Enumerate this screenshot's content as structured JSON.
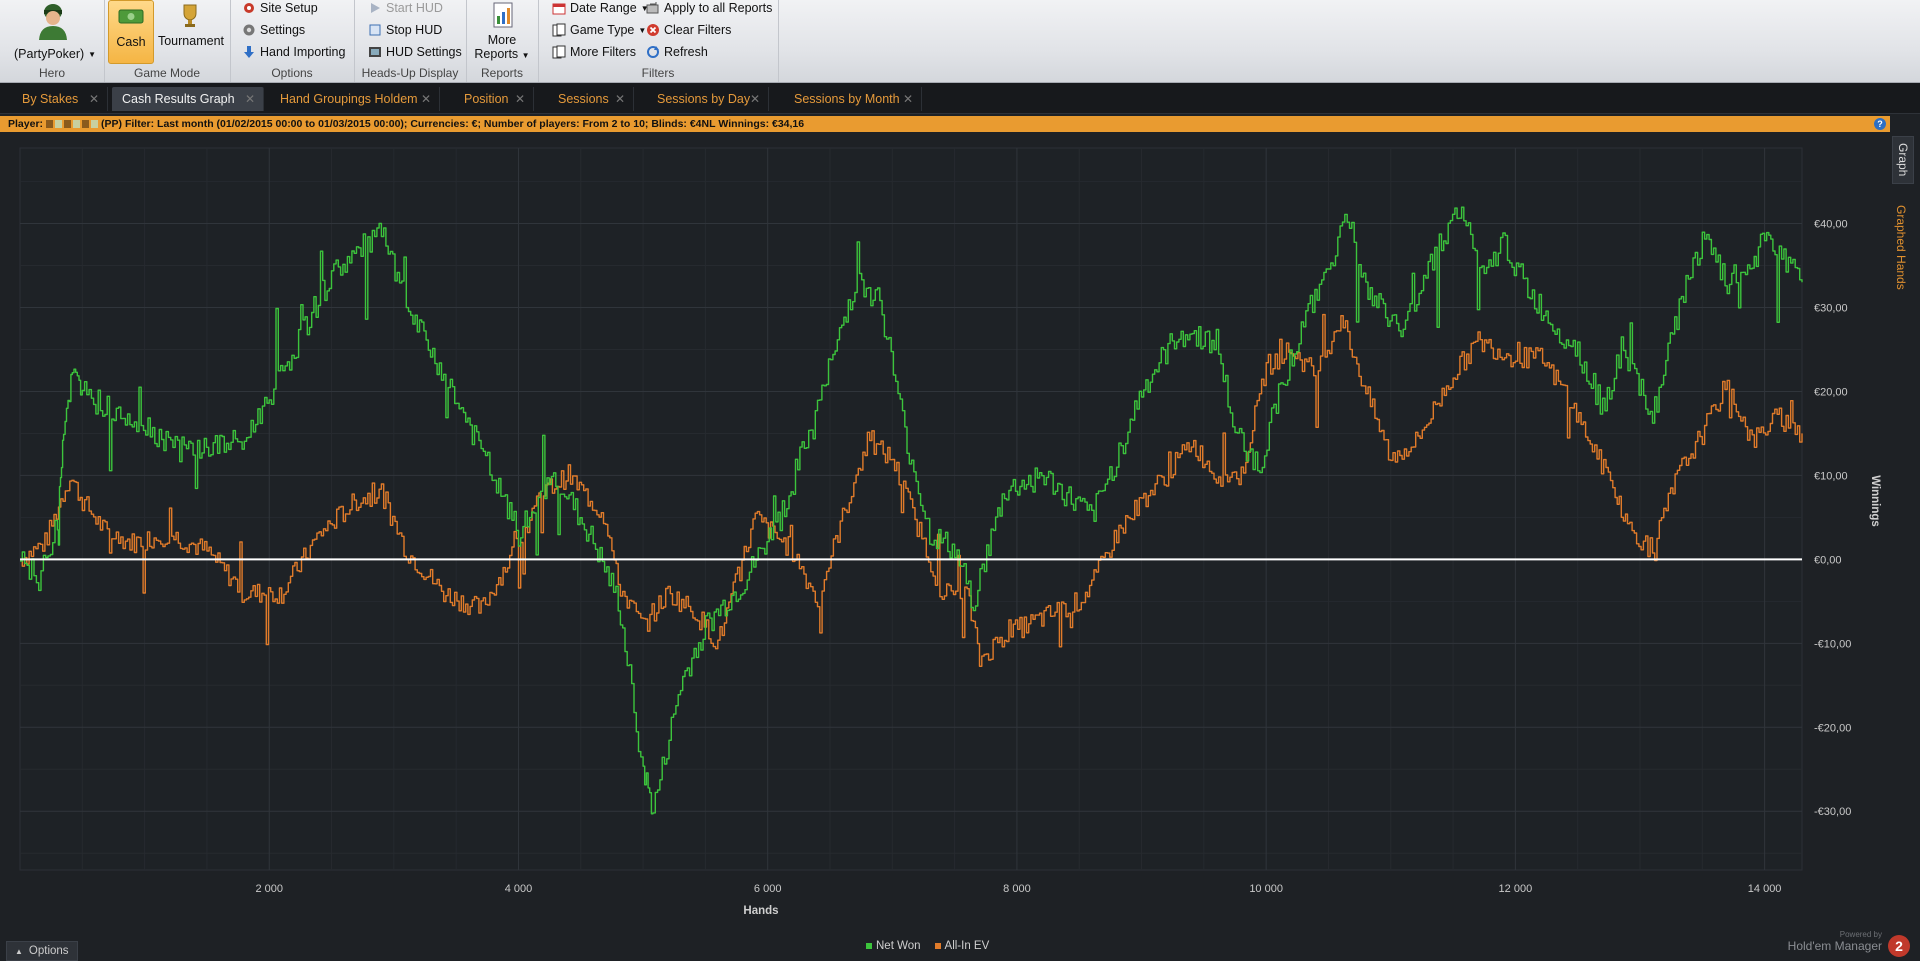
{
  "ribbon": {
    "hero": {
      "name": "(PartyPoker)",
      "caption": "Hero"
    },
    "game_mode": {
      "cash": "Cash",
      "tournament": "Tournament",
      "caption": "Game Mode"
    },
    "options": {
      "site_setup": "Site Setup",
      "settings": "Settings",
      "hand_importing": "Hand Importing",
      "caption": "Options"
    },
    "hud": {
      "start": "Start HUD",
      "stop": "Stop HUD",
      "settings": "HUD Settings",
      "caption": "Heads-Up Display"
    },
    "reports": {
      "more_line1": "More",
      "more_line2": "Reports",
      "caption": "Reports"
    },
    "filters": {
      "date_range": "Date Range",
      "game_type": "Game Type",
      "more_filters": "More Filters",
      "apply_all": "Apply to all Reports",
      "clear": "Clear Filters",
      "refresh": "Refresh",
      "caption": "Filters"
    }
  },
  "tabs": [
    {
      "label": "By Stakes",
      "active": false
    },
    {
      "label": "Cash Results Graph",
      "active": true
    },
    {
      "label": "Hand Groupings Holdem",
      "active": false
    },
    {
      "label": "Position",
      "active": false
    },
    {
      "label": "Sessions",
      "active": false
    },
    {
      "label": "Sessions by Day",
      "active": false
    },
    {
      "label": "Sessions by Month",
      "active": false
    }
  ],
  "filter_bar": {
    "player_label": "Player:",
    "player_suffix": "(PP)",
    "filter_label": "Filter:",
    "filter_text": "Last month (01/02/2015 00:00 to 01/03/2015 00:00); Currencies: €; Number of players: From 2 to 10; Blinds: €4NL",
    "winnings_label": "Winnings:",
    "winnings_value": "€34,16"
  },
  "side_tabs": {
    "graph": "Graph",
    "graphed_hands": "Graphed Hands"
  },
  "footer": {
    "options": "Options",
    "powered_by": "Powered by",
    "brand": "Hold'em Manager",
    "logo_num": "2"
  },
  "colors": {
    "net_won": "#3cc43c",
    "all_in_ev": "#e07b2a",
    "zero_line": "#ffffff",
    "accent": "#e99b30"
  },
  "chart_data": {
    "type": "line",
    "xlabel": "Hands",
    "ylabel": "Winnings",
    "xlim": [
      0,
      14300
    ],
    "ylim": [
      -37,
      49
    ],
    "x_ticks": [
      2000,
      4000,
      6000,
      8000,
      10000,
      12000,
      14000
    ],
    "x_tick_labels": [
      "2 000",
      "4 000",
      "6 000",
      "8 000",
      "10 000",
      "12 000",
      "14 000"
    ],
    "y_ticks": [
      40,
      30,
      20,
      10,
      0,
      -10,
      -20,
      -30
    ],
    "y_tick_labels": [
      "€40,00",
      "€30,00",
      "€20,00",
      "€10,00",
      "€0,00",
      "-€10,00",
      "-€20,00",
      "-€30,00"
    ],
    "grid": true,
    "legend": "bottom-center",
    "series": [
      {
        "name": "Net Won",
        "x": [
          0,
          150,
          300,
          350,
          420,
          500,
          700,
          900,
          1300,
          1800,
          2200,
          2500,
          2900,
          3100,
          3400,
          3700,
          4000,
          4300,
          4600,
          4800,
          5000,
          5080,
          5300,
          5500,
          5800,
          6100,
          6400,
          6700,
          6900,
          7100,
          7300,
          7500,
          7650,
          7900,
          8200,
          8600,
          8800,
          9000,
          9300,
          9600,
          9750,
          9950,
          10100,
          10300,
          10500,
          10650,
          10800,
          11100,
          11300,
          11550,
          11750,
          11900,
          12100,
          12300,
          12500,
          12700,
          12850,
          13100,
          13350,
          13500,
          13700,
          13900,
          14000,
          14100,
          14300
        ],
        "values": [
          1,
          -3,
          5,
          16,
          22,
          20,
          18,
          17,
          13,
          14,
          25,
          34,
          39,
          30,
          22,
          13,
          3,
          10,
          2,
          -5,
          -25,
          -30,
          -15,
          -8,
          -3,
          5,
          18,
          33,
          31,
          15,
          3,
          1,
          -5,
          8,
          10,
          5,
          12,
          20,
          27,
          26,
          15,
          11,
          20,
          28,
          35,
          41,
          32,
          27,
          35,
          42,
          33,
          38,
          32,
          28,
          25,
          18,
          25,
          17,
          32,
          38,
          33,
          35,
          39,
          37,
          33
        ]
      },
      {
        "name": "All-In EV",
        "x": [
          0,
          200,
          400,
          500,
          700,
          900,
          1200,
          1500,
          1800,
          2100,
          2400,
          2700,
          2900,
          3100,
          3400,
          3700,
          4000,
          4200,
          4400,
          4700,
          4800,
          5000,
          5200,
          5400,
          5600,
          5900,
          6200,
          6400,
          6600,
          6800,
          7000,
          7200,
          7400,
          7600,
          7700,
          7900,
          8200,
          8500,
          8600,
          8800,
          9000,
          9200,
          9400,
          9600,
          9800,
          10000,
          10200,
          10400,
          10600,
          10800,
          11000,
          11200,
          11500,
          11700,
          12000,
          12200,
          12400,
          12600,
          12800,
          12900,
          13100,
          13300,
          13500,
          13700,
          13900,
          14100,
          14300
        ],
        "values": [
          0,
          2,
          10,
          7,
          3,
          2,
          3,
          1,
          -4,
          -4,
          3,
          7,
          8,
          1,
          -4,
          -6,
          2,
          8,
          10,
          5,
          -3,
          -8,
          -4,
          -6,
          -10,
          5,
          1,
          -5,
          5,
          14,
          12,
          4,
          -4,
          -4,
          -12,
          -9,
          -7,
          -5,
          -3,
          3,
          7,
          10,
          14,
          10,
          10,
          23,
          25,
          22,
          29,
          20,
          12,
          14,
          22,
          26,
          24,
          24,
          20,
          14,
          8,
          4,
          1,
          10,
          15,
          21,
          14,
          17,
          15
        ]
      }
    ]
  }
}
